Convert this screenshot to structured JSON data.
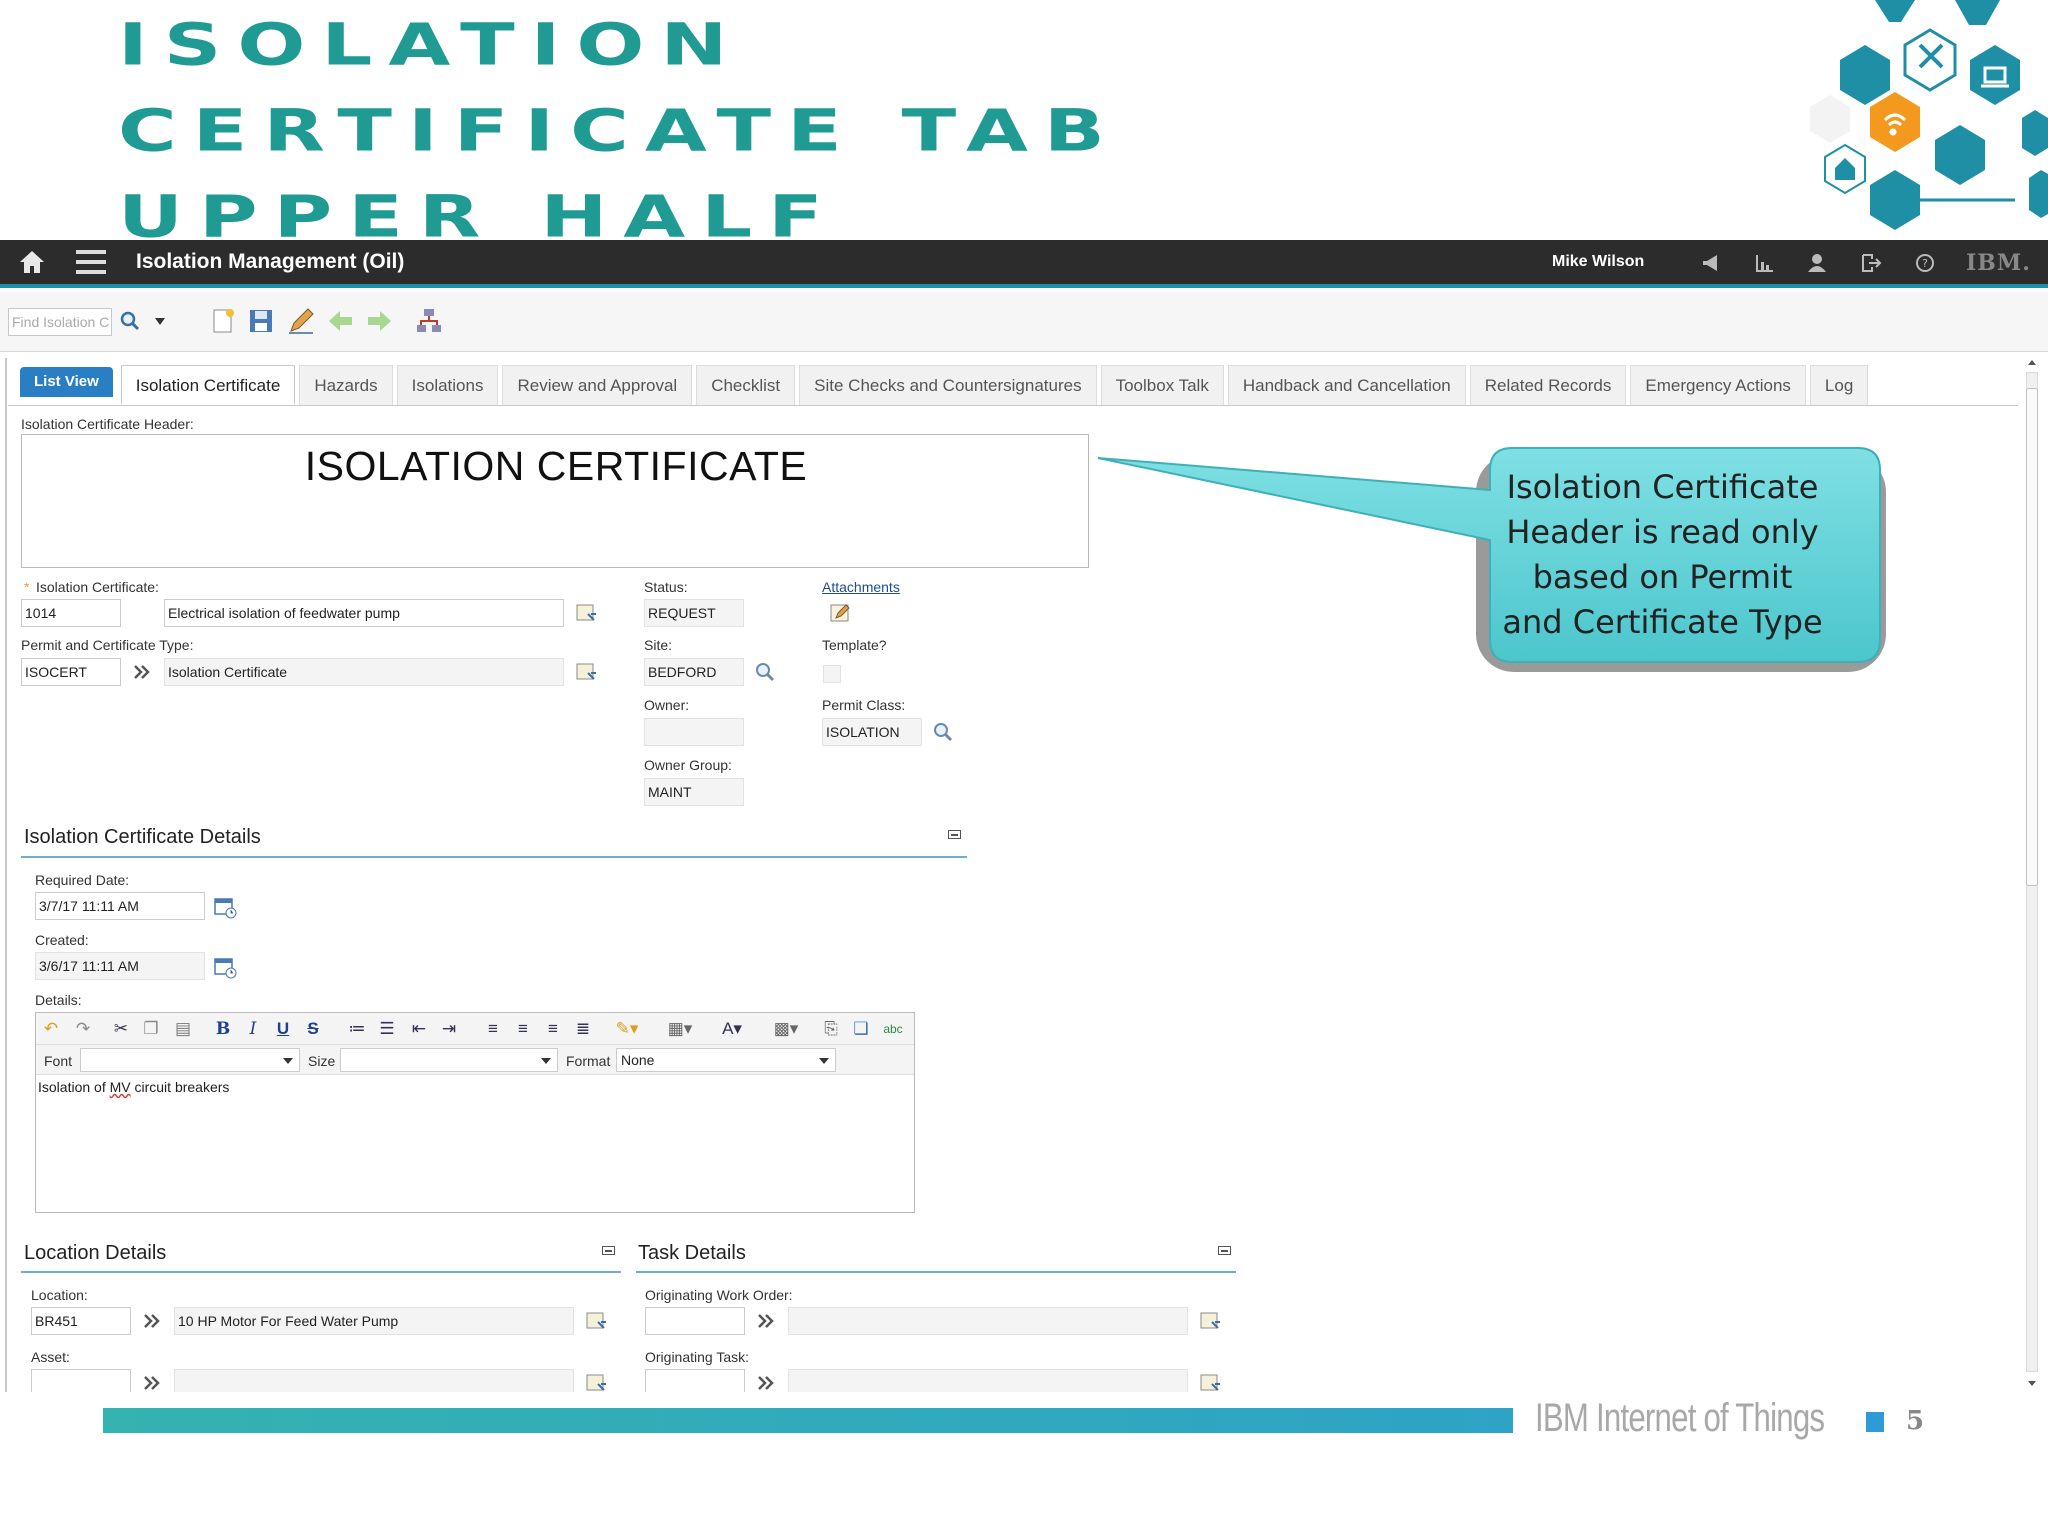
{
  "slide": {
    "title_lines": [
      "Isolation",
      "Certificate  Tab",
      "Upper  Half"
    ],
    "footer_brand": "IBM Internet of Things",
    "page_number": "5"
  },
  "appbar": {
    "title": "Isolation Management (Oil)",
    "user": "Mike Wilson",
    "ibm_logo": "IBM."
  },
  "toolbar": {
    "find_placeholder": "Find Isolation C"
  },
  "tabs": {
    "list_view": "List View",
    "items": [
      "Isolation Certificate",
      "Hazards",
      "Isolations",
      "Review and Approval",
      "Checklist",
      "Site Checks and Countersignatures",
      "Toolbox Talk",
      "Handback and Cancellation",
      "Related Records",
      "Emergency Actions",
      "Log"
    ],
    "active_index": 0
  },
  "header": {
    "label": "Isolation Certificate Header:",
    "text": "ISOLATION CERTIFICATE"
  },
  "fields": {
    "cert_label": "Isolation Certificate:",
    "cert_id": "1014",
    "cert_desc": "Electrical isolation of feedwater pump",
    "type_label": "Permit and Certificate Type:",
    "type_code": "ISOCERT",
    "type_desc": "Isolation Certificate",
    "status_label": "Status:",
    "status": "REQUEST",
    "site_label": "Site:",
    "site": "BEDFORD",
    "owner_label": "Owner:",
    "owner": "",
    "owner_group_label": "Owner Group:",
    "owner_group": "MAINT",
    "attachments_label": "Attachments",
    "template_label": "Template?",
    "permit_class_label": "Permit Class:",
    "permit_class": "ISOLATION"
  },
  "details": {
    "section_title": "Isolation Certificate Details",
    "required_date_label": "Required Date:",
    "required_date": "3/7/17 11:11 AM",
    "created_label": "Created:",
    "created": "3/6/17 11:11 AM",
    "details_label": "Details:",
    "font_label": "Font",
    "size_label": "Size",
    "format_label": "Format",
    "format_value": "None",
    "body_pre": "Isolation of ",
    "body_spell": "MV",
    "body_post": " circuit breakers"
  },
  "location": {
    "section_title": "Location Details",
    "location_label": "Location:",
    "location": "BR451",
    "location_desc": "10 HP Motor For Feed Water Pump",
    "asset_label": "Asset:"
  },
  "task": {
    "section_title": "Task Details",
    "work_order_label": "Originating Work Order:",
    "task_label": "Originating Task:"
  },
  "callout": {
    "lines": [
      "Isolation Certificate",
      "Header is read only",
      "based on Permit",
      "and Certificate Type"
    ]
  },
  "colors": {
    "title_teal": "#1f9b93",
    "appbar_bg": "#2c2c2c",
    "accent_blue": "#1a8fa8",
    "list_view_blue": "#2a7ec4",
    "callout_fill": "#5fd3d8",
    "hex_orange": "#f39a1e",
    "hex_teal": "#1e8fa4"
  }
}
